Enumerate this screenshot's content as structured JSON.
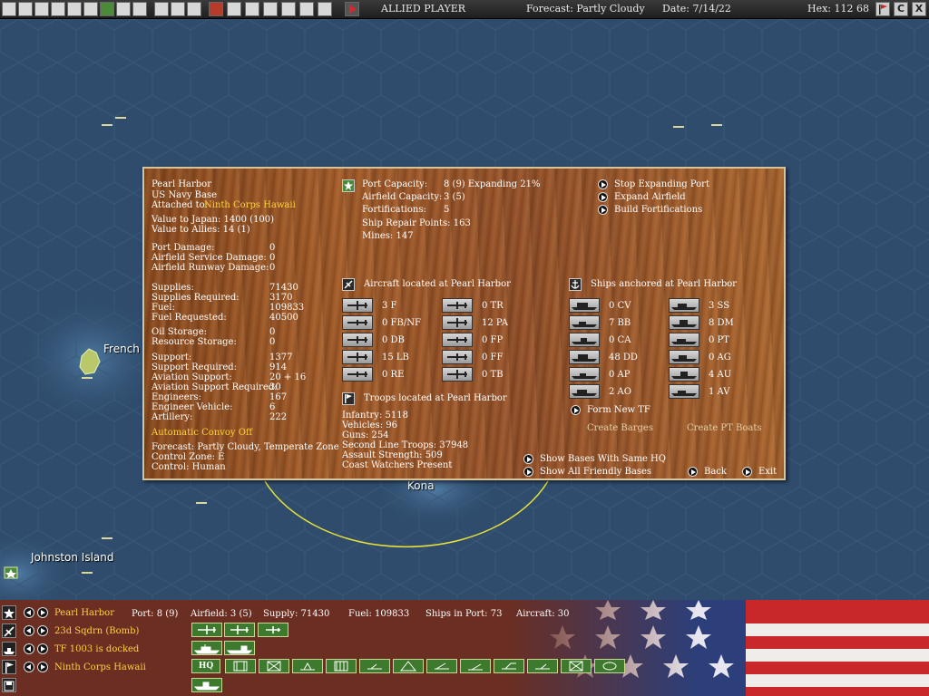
{
  "toolbar": {
    "player": "ALLIED PLAYER",
    "forecast": "Forecast: Partly Cloudy",
    "date": "Date: 7/14/22",
    "hex": "Hex: 112 68",
    "right_buttons": [
      "flag-icon",
      "C",
      "X"
    ]
  },
  "map": {
    "labels": {
      "french": "French",
      "kona": "Kona",
      "johnston": "Johnston Island"
    }
  },
  "panel": {
    "base": {
      "name": "Pearl Harbor",
      "type": "US Navy Base",
      "attached_label": "Attached to:",
      "attached_value": "Ninth Corps Hawaii",
      "value_japan": "Value to Japan: 1400 (100)",
      "value_allies": "Value to Allies: 14 (1)"
    },
    "damage": [
      {
        "label": "Port Damage:",
        "value": "0"
      },
      {
        "label": "Airfield Service Damage:",
        "value": "0"
      },
      {
        "label": "Airfield Runway Damage:",
        "value": "0"
      }
    ],
    "supplies": [
      {
        "label": "Supplies:",
        "value": "71430"
      },
      {
        "label": "Supplies Required:",
        "value": "3170"
      },
      {
        "label": "Fuel:",
        "value": "109833"
      },
      {
        "label": "Fuel Requested:",
        "value": "40500"
      }
    ],
    "storage": [
      {
        "label": "Oil Storage:",
        "value": "0"
      },
      {
        "label": "Resource Storage:",
        "value": "0"
      }
    ],
    "support": [
      {
        "label": "Support:",
        "value": "1377"
      },
      {
        "label": "Support Required:",
        "value": "914"
      },
      {
        "label": "Aviation Support:",
        "value": "20 + 16"
      },
      {
        "label": "Aviation Support Required:",
        "value": "30"
      },
      {
        "label": "Engineers:",
        "value": "167"
      },
      {
        "label": "Engineer Vehicle:",
        "value": "6"
      },
      {
        "label": "Artillery:",
        "value": "222"
      }
    ],
    "convoy": "Automatic Convoy Off",
    "forecast": "Forecast: Partly Cloudy, Temperate Zone",
    "control_zone": "Control Zone: E",
    "control": "Control:   Human",
    "capacity": [
      {
        "label": "Port Capacity:",
        "value": "8 (9) Expanding 21%"
      },
      {
        "label": "Airfield Capacity:",
        "value": "3 (5)"
      },
      {
        "label": "Fortifications:",
        "value": "5"
      }
    ],
    "repair": "Ship Repair Points: 163",
    "mines": "Mines: 147",
    "actions": [
      "Stop Expanding Port",
      "Expand Airfield",
      "Build Fortifications"
    ],
    "aircraft_header": "Aircraft located at Pearl Harbor",
    "aircraft": [
      [
        "3 F",
        "0 TR"
      ],
      [
        "0 FB/NF",
        "12 PA"
      ],
      [
        "0 DB",
        "0 FP"
      ],
      [
        "15 LB",
        "0 FF"
      ],
      [
        "0 RE",
        "0 TB"
      ]
    ],
    "ships_header": "Ships anchored at Pearl Harbor",
    "ships": [
      [
        "0 CV",
        "3 SS"
      ],
      [
        "7 BB",
        "8 DM"
      ],
      [
        "0 CA",
        "0 PT"
      ],
      [
        "48 DD",
        "0 AG"
      ],
      [
        "0 AP",
        "4 AU"
      ],
      [
        "2 AO",
        "1 AV"
      ]
    ],
    "form_tf": "Form New TF",
    "create_barges": "Create Barges",
    "create_pt": "Create PT Boats",
    "troops_header": "Troops located at Pearl Harbor",
    "troops": [
      "Infantry: 5118",
      "Vehicles: 96",
      "Guns: 254",
      "Second Line Troops: 37948",
      "Assault Strength: 509",
      "Coast Watchers Present"
    ],
    "show_hq": "Show Bases With Same HQ",
    "show_all": "Show All Friendly Bases",
    "back": "Back",
    "exit": "Exit"
  },
  "bottom": {
    "rows": [
      {
        "text": "Pearl Harbor",
        "icon": "star-icon"
      },
      {
        "text": "23d Sqdrn (Bomb)",
        "icon": "plane-icon"
      },
      {
        "text": "TF 1003 is docked",
        "icon": "ship-icon"
      },
      {
        "text": "Ninth Corps Hawaii",
        "icon": "flag-icon"
      }
    ],
    "stats": {
      "port": "Port: 8 (9)",
      "airfield": "Airfield: 3 (5)",
      "supply": "Supply: 71430",
      "fuel": "Fuel: 109833",
      "ships": "Ships in Port: 73",
      "aircraft": "Aircraft: 30"
    },
    "hq_label": "HQ"
  },
  "colors": {
    "panel_wood": "#a35c2a",
    "highlight_text": "#ffd23c",
    "ocean": "#2f4c6c",
    "button_green": "#3e7a2e"
  }
}
